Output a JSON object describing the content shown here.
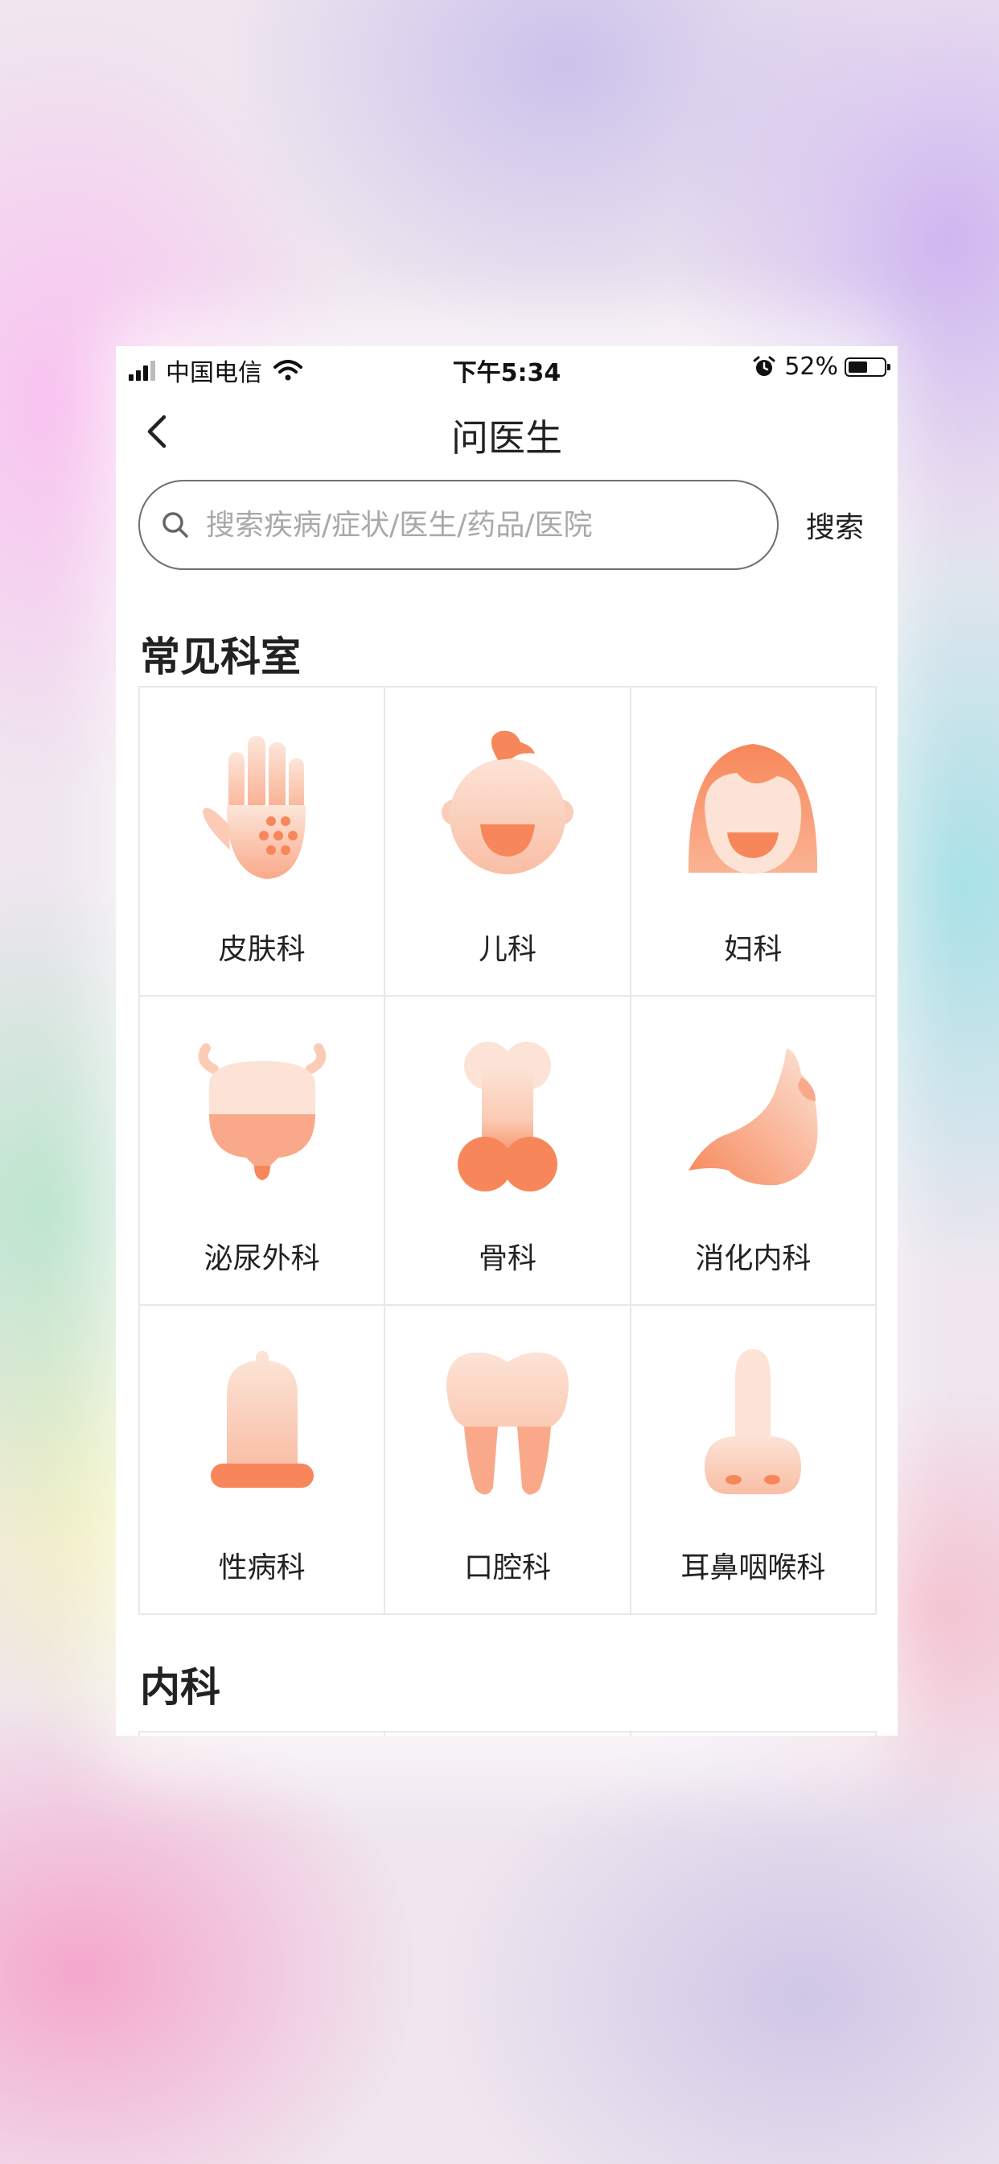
{
  "status_bar": {
    "carrier": "中国电信",
    "time": "下午5:34",
    "battery": "52%",
    "battery_level": 0.52,
    "icons": [
      "signal-icon",
      "wifi-icon",
      "alarm-icon",
      "battery-icon"
    ]
  },
  "header": {
    "title": "问医生",
    "back_icon": "chevron-left-icon"
  },
  "search": {
    "placeholder": "搜索疾病/症状/医生/药品/医院",
    "value": "",
    "button_label": "搜索"
  },
  "common_departments": {
    "title": "常见科室",
    "items": [
      {
        "label": "皮肤科",
        "icon": "hand-icon"
      },
      {
        "label": "儿科",
        "icon": "baby-icon"
      },
      {
        "label": "妇科",
        "icon": "woman-icon"
      },
      {
        "label": "泌尿外科",
        "icon": "bladder-icon"
      },
      {
        "label": "骨科",
        "icon": "bone-icon"
      },
      {
        "label": "消化内科",
        "icon": "stomach-icon"
      },
      {
        "label": "性病科",
        "icon": "condom-icon"
      },
      {
        "label": "口腔科",
        "icon": "tooth-icon"
      },
      {
        "label": "耳鼻咽喉科",
        "icon": "nose-icon"
      }
    ]
  },
  "internal_medicine": {
    "title": "内科"
  },
  "colors": {
    "accent": "#F7875A",
    "icon_light": "#FBD6C4"
  }
}
